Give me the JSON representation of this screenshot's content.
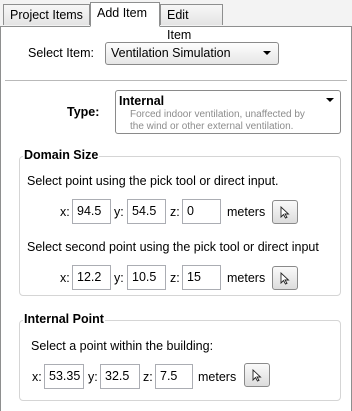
{
  "tabs": [
    "Project Items",
    "Add Item",
    "Edit Item"
  ],
  "select_item": {
    "label": "Select Item:",
    "value": "Ventilation Simulation"
  },
  "type": {
    "label": "Type:",
    "value": "Internal",
    "description_line1": "Forced indoor ventilation, unaffected by",
    "description_line2": "the wind or other external ventilation."
  },
  "domain_size": {
    "title": "Domain Size",
    "first_prompt": "Select point using the pick tool or direct input.",
    "second_prompt": "Select second point using the pick tool or direct input",
    "point1": {
      "x_label": "x:",
      "x": "94.5",
      "y_label": "y:",
      "y": "54.5",
      "z_label": "z:",
      "z": "0",
      "units": "meters"
    },
    "point2": {
      "x_label": "x:",
      "x": "12.2",
      "y_label": "y:",
      "y": "10.5",
      "z_label": "z:",
      "z": "15",
      "units": "meters"
    }
  },
  "internal_point": {
    "title": "Internal Point",
    "prompt": "Select a point within the building:",
    "point": {
      "x_label": "x:",
      "x": "53.35",
      "y_label": "y:",
      "y": "32.5",
      "z_label": "z:",
      "z": "7.5",
      "units": "meters"
    }
  },
  "icons": {
    "pick_tool": "cursor-arrow-icon",
    "dropdown": "chevron-down-icon"
  }
}
